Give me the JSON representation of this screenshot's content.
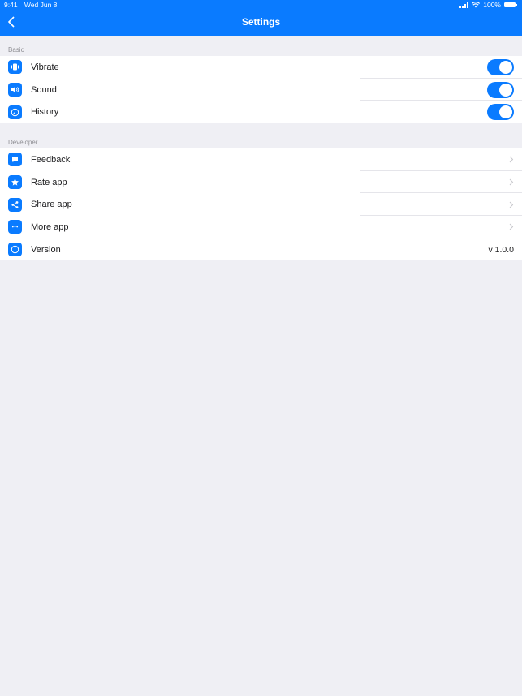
{
  "status_bar": {
    "time": "9:41",
    "date": "Wed Jun 8",
    "battery": "100%"
  },
  "header": {
    "title": "Settings",
    "back_icon": "chevron-left-icon"
  },
  "sections": [
    {
      "label": "Basic",
      "items": [
        {
          "label": "Vibrate",
          "icon": "vibrate-icon",
          "toggle": true
        },
        {
          "label": "Sound",
          "icon": "speaker-icon",
          "toggle": true
        },
        {
          "label": "History",
          "icon": "clock-icon",
          "toggle": true
        }
      ]
    },
    {
      "label": "Developer",
      "items": [
        {
          "label": "Feedback",
          "icon": "chat-bubble-icon"
        },
        {
          "label": "Rate app",
          "icon": "star-icon"
        },
        {
          "label": "Share app",
          "icon": "share-icon"
        },
        {
          "label": "More app",
          "icon": "more-icon"
        },
        {
          "label": "Version",
          "icon": "info-icon",
          "value": "v 1.0.0"
        }
      ]
    }
  ],
  "colors": {
    "accent": "#0a7bff",
    "background": "#efeff4"
  }
}
